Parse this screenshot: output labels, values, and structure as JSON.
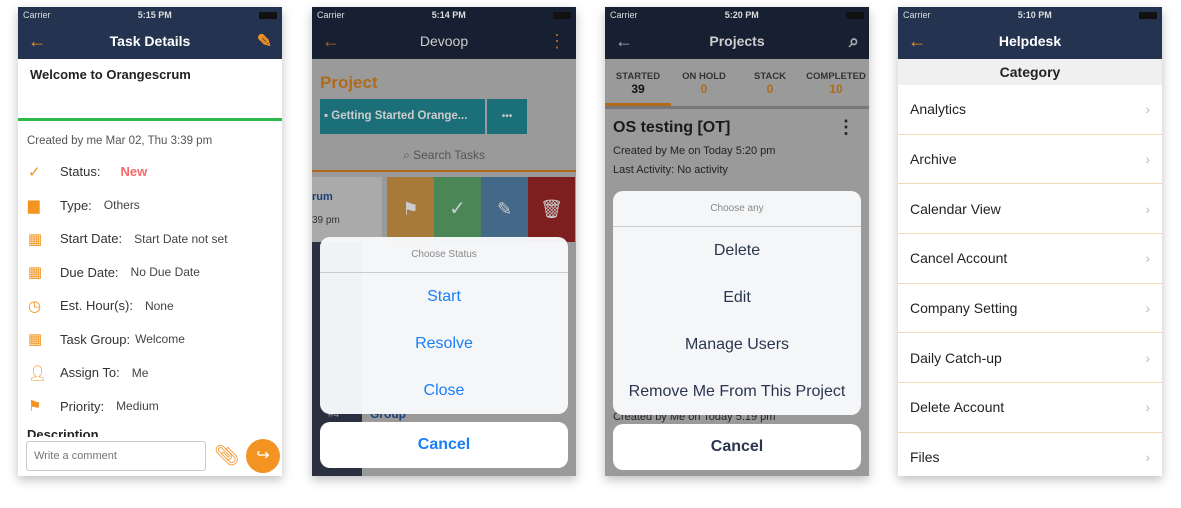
{
  "phones": [
    {
      "carrier": "Carrier",
      "time": "5:15 PM",
      "title": "Task Details",
      "task_title": "Welcome to Orangescrum",
      "created": "Created by me Mar 02, Thu 3:39 pm",
      "fields": [
        {
          "icon": "check-icon",
          "label": "Status:",
          "value": "New"
        },
        {
          "icon": "document-icon",
          "label": "Type:",
          "value": "Others"
        },
        {
          "icon": "calendar-icon",
          "label": "Start Date:",
          "value": "Start Date not set"
        },
        {
          "icon": "calendar-icon",
          "label": "Due Date:",
          "value": "No Due Date"
        },
        {
          "icon": "clock-icon",
          "label": "Est. Hour(s):",
          "value": "None"
        },
        {
          "icon": "grid-icon",
          "label": "Task Group:",
          "value": "Welcome"
        },
        {
          "icon": "user-icon",
          "label": "Assign To:",
          "value": "Me"
        },
        {
          "icon": "flag-icon",
          "label": "Priority:",
          "value": "Medium"
        }
      ],
      "description_label": "Description",
      "comment_placeholder": "Write a comment"
    },
    {
      "carrier": "Carrier",
      "time": "5:14 PM",
      "title": "Devoop",
      "section": "Project",
      "project_button": "Getting Started Orange...",
      "more": "•••",
      "search_placeholder": "Search Tasks",
      "bg_text1": "rum",
      "bg_text2": "39 pm",
      "bg_text3": "Group",
      "bg_text4": "#4",
      "sheet": {
        "header": "Choose Status",
        "options": [
          "Start",
          "Resolve",
          "Close"
        ],
        "cancel": "Cancel"
      }
    },
    {
      "carrier": "Carrier",
      "time": "5:20 PM",
      "title": "Projects",
      "tabs": [
        {
          "label": "STARTED",
          "count": "39"
        },
        {
          "label": "ON HOLD",
          "count": "0"
        },
        {
          "label": "STACK",
          "count": "0"
        },
        {
          "label": "COMPLETED",
          "count": "10"
        }
      ],
      "project_name": "OS testing [OT]",
      "created": "Created by Me on Today 5:20 pm",
      "last_activity": "Last Activity: No activity",
      "bg_created2": "Created by Me on Today 5:19 pm",
      "sheet": {
        "header": "Choose any",
        "options": [
          "Delete",
          "Edit",
          "Manage Users",
          "Remove Me From This Project"
        ],
        "cancel": "Cancel"
      }
    },
    {
      "carrier": "Carrier",
      "time": "5:10 PM",
      "title": "Helpdesk",
      "category": "Category",
      "items": [
        "Analytics",
        "Archive",
        "Calendar View",
        "Cancel Account",
        "Company Setting",
        "Daily Catch-up",
        "Delete Account",
        "Files"
      ]
    }
  ],
  "colors": {
    "navbar": "#243350",
    "accent": "#f39422",
    "ios_blue": "#1a7ef5",
    "status_new": "#f26b6b",
    "green": "#2db84c",
    "teal": "#1e9eaa"
  }
}
